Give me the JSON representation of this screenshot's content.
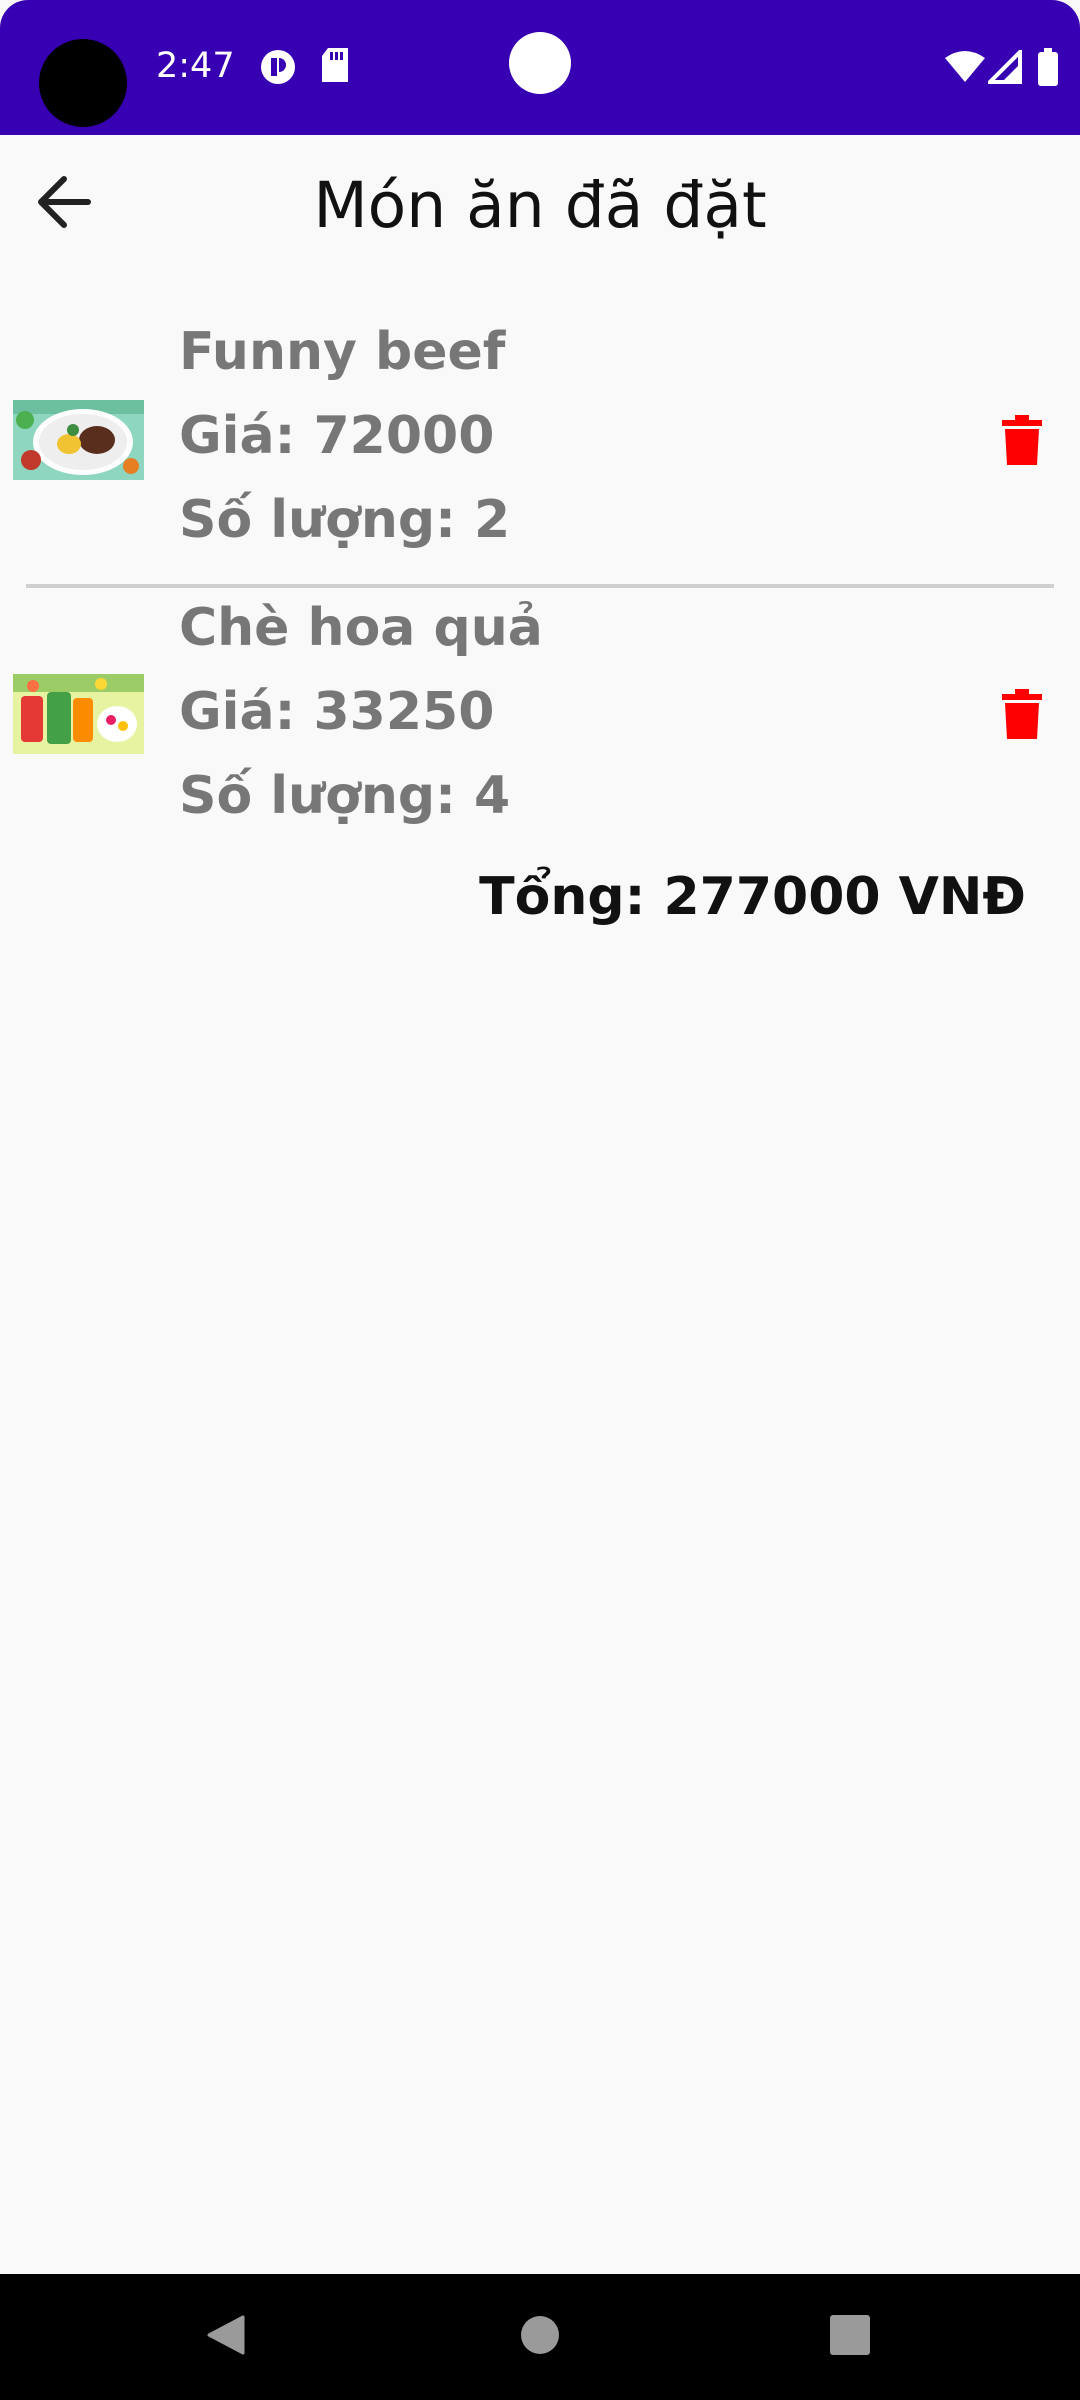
{
  "status_bar": {
    "time": "2:47",
    "background_color": "#3700b3",
    "icons_left": [
      "media-icon",
      "sd-card-icon"
    ],
    "icons_right": [
      "wifi-icon",
      "signal-icon",
      "battery-icon"
    ]
  },
  "app_bar": {
    "title": "Món ăn đã đặt",
    "back_icon": "arrow-left-icon"
  },
  "orders": [
    {
      "name": "Funny beef",
      "price_text": "Giá: 72000",
      "quantity_text": "Số lượng: 2",
      "image": "beef-dish-thumbnail",
      "delete_icon": "trash-icon"
    },
    {
      "name": "Chè hoa quả",
      "price_text": "Giá: 33250",
      "quantity_text": "Số lượng: 4",
      "image": "fruit-dessert-thumbnail",
      "delete_icon": "trash-icon"
    }
  ],
  "total_text": "Tổng: 277000 VNĐ",
  "nav_bar": {
    "buttons": [
      "back-triangle-icon",
      "home-circle-icon",
      "recents-square-icon"
    ]
  },
  "colors": {
    "accent": "#3700b3",
    "delete": "#ff0000",
    "item_text": "#777777",
    "background": "#f9f9f9"
  }
}
